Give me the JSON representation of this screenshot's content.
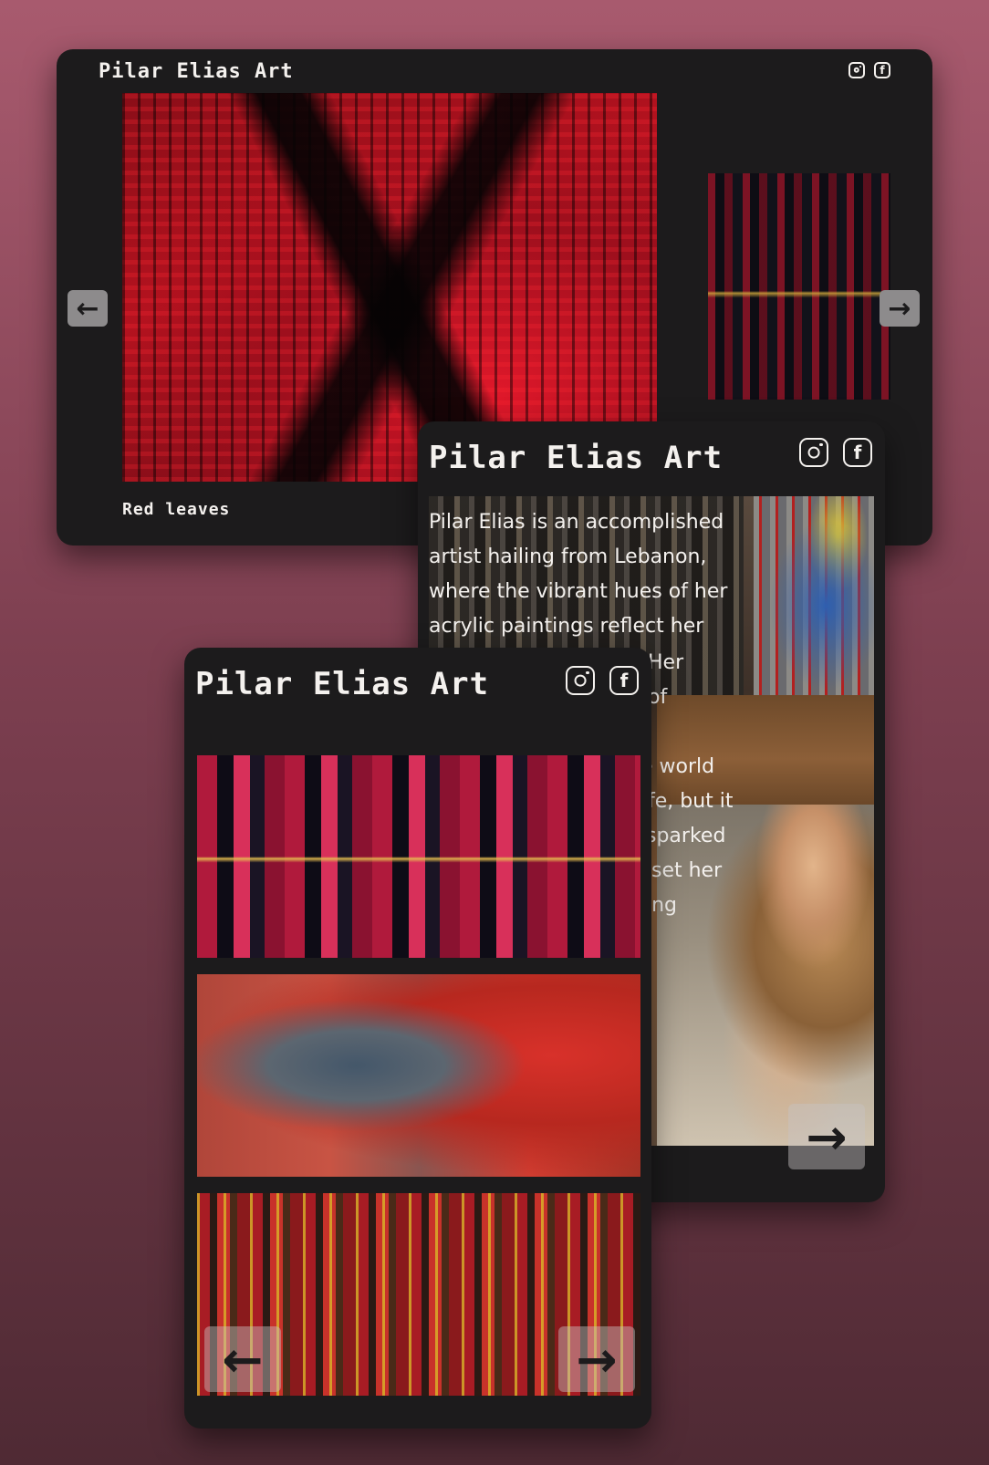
{
  "site_title": "Pilar Elias Art",
  "desktop": {
    "caption": "Red leaves",
    "prev_icon": "arrow-left-icon",
    "next_icon": "arrow-right-icon"
  },
  "tablet": {
    "bio_lines": [
      "Pilar Elias is an accomplished",
      "artist hailing from Lebanon,",
      "where the vibrant hues of her",
      "acrylic paintings reflect her"
    ],
    "bio_fragments": [
      "Her",
      "of",
      "e world",
      "fe, but it",
      "sparked",
      "set her",
      "ing"
    ]
  },
  "icons": {
    "instagram": "instagram-icon",
    "facebook": "facebook-icon",
    "facebook_glyph": "f"
  },
  "colors": {
    "card": "#1c1b1c",
    "text": "#f4f1ee",
    "accent_red": "#c8102e"
  }
}
